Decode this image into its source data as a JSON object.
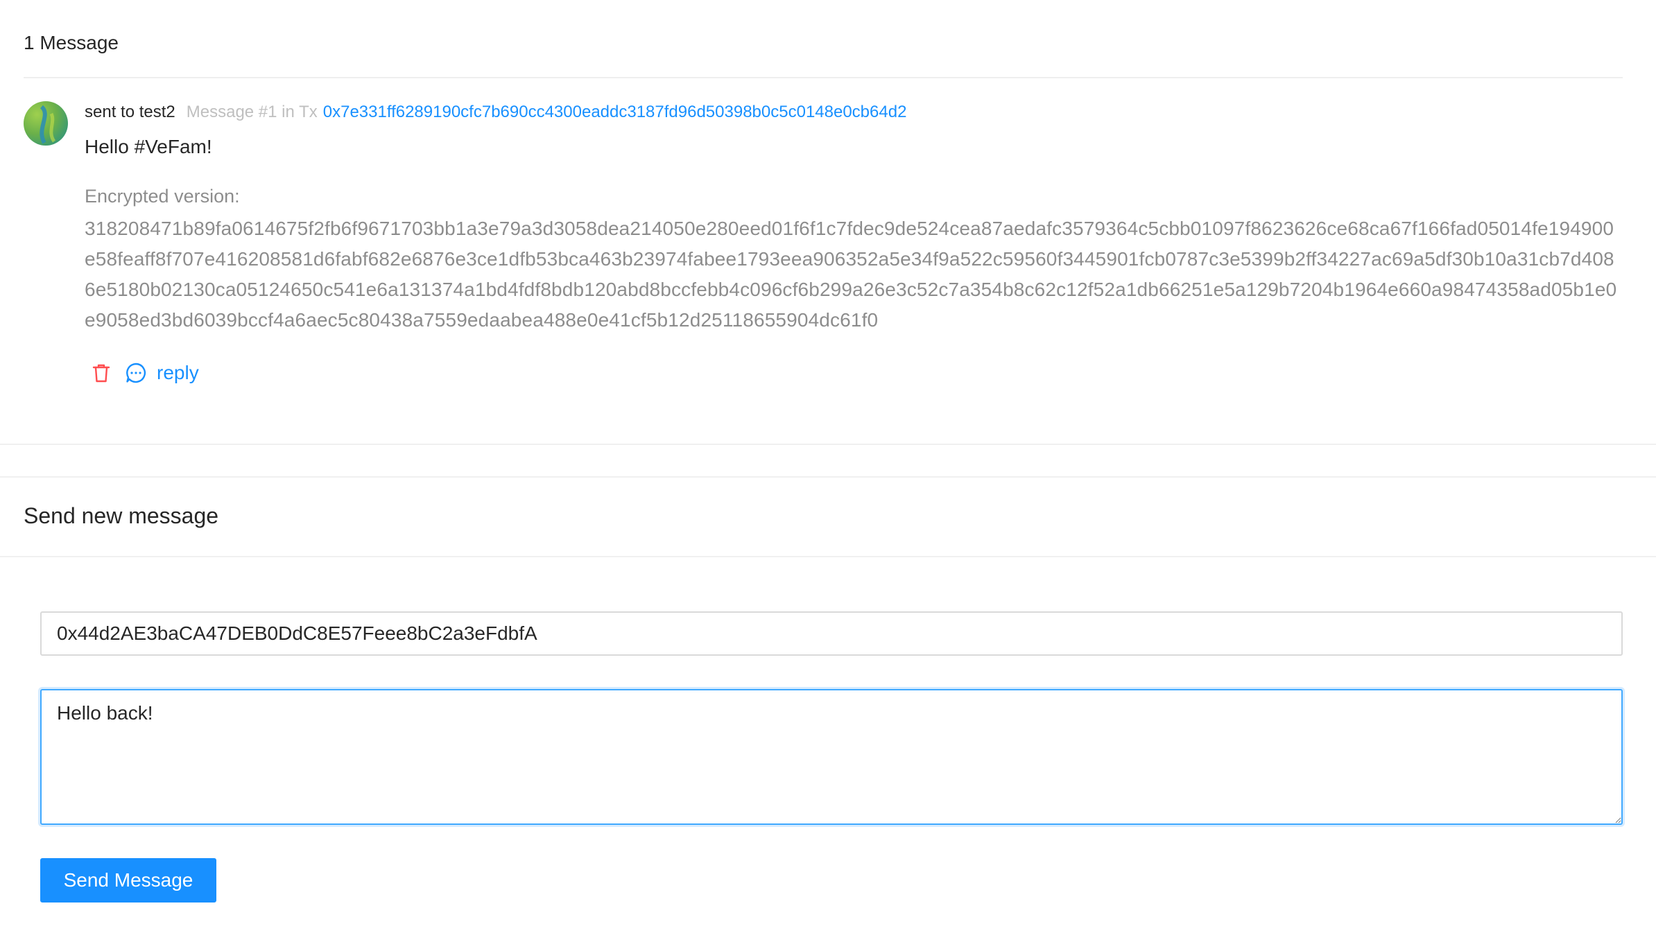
{
  "messages": {
    "count_label": "1 Message",
    "items": [
      {
        "author": "sent to test2",
        "subtitle": "Message #1 in Tx",
        "tx_hash": "0x7e331ff6289190cfc7b690cc4300eaddc3187fd96d50398b0c5c0148e0cb64d2",
        "body": "Hello #VeFam!",
        "encrypted_label": "Encrypted version:",
        "encrypted_text": "318208471b89fa0614675f2fb6f9671703bb1a3e79a3d3058dea214050e280eed01f6f1c7fdec9de524cea87aedafc3579364c5cbb01097f8623626ce68ca67f166fad05014fe194900e58feaff8f707e416208581d6fabf682e6876e3ce1dfb53bca463b23974fabee1793eea906352a5e34f9a522c59560f3445901fcb0787c3e5399b2ff34227ac69a5df30b10a31cb7d4086e5180b02130ca05124650c541e6a131374a1bd4fdf8bdb120abd8bccfebb4c096cf6b299a26e3c52c7a354b8c62c12f52a1db66251e5a129b7204b1964e660a98474358ad05b1e0e9058ed3bd6039bccf4a6aec5c80438a7559edaabea488e0e41cf5b12d25118655904dc61f0",
        "reply_label": "reply",
        "icons": {
          "delete": "trash-icon",
          "reply": "chat-bubble-icon"
        }
      }
    ]
  },
  "compose": {
    "title": "Send new message",
    "recipient_value": "0x44d2AE3baCA47DEB0DdC8E57Feee8bC2a3eFdbfA",
    "message_value": "Hello back!",
    "send_label": "Send Message"
  },
  "colors": {
    "primary": "#1890ff",
    "danger": "#ff4d4f",
    "muted": "#bfbfbf",
    "secondary_text": "#8c8c8c"
  }
}
